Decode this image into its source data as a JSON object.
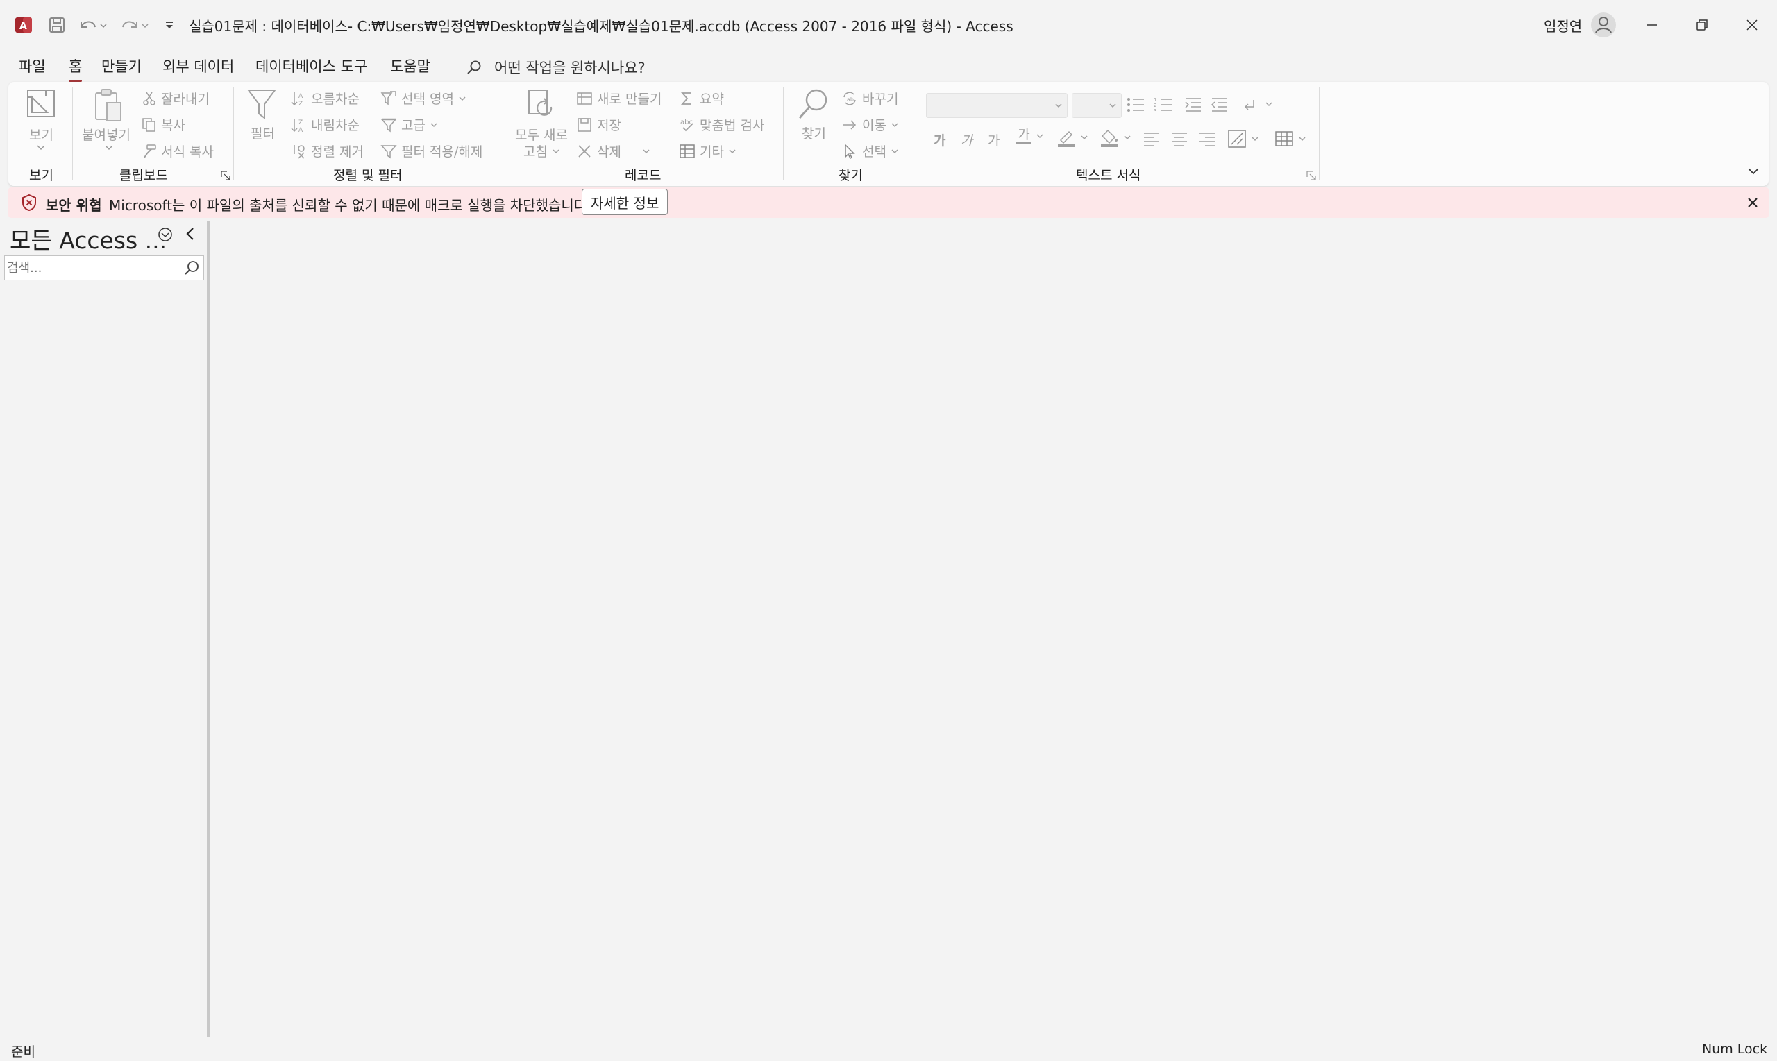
{
  "title_bar": {
    "title": "실습01문제 : 데이터베이스- C:₩Users₩임정연₩Desktop₩실습예제₩실습01문제.accdb (Access 2007 - 2016 파일 형식)  -  Access",
    "user_name": "임정연",
    "app_icon": "access-app-icon",
    "qat_icons": [
      "save-icon",
      "undo-icon",
      "redo-icon",
      "customize-qat-icon"
    ]
  },
  "menu": {
    "tabs": [
      {
        "label": "파일"
      },
      {
        "label": "홈",
        "active": true
      },
      {
        "label": "만들기"
      },
      {
        "label": "외부 데이터"
      },
      {
        "label": "데이터베이스 도구"
      },
      {
        "label": "도움말"
      }
    ],
    "tell_me": "어떤 작업을 원하시나요?"
  },
  "ribbon": {
    "groups": {
      "view": {
        "label": "보기",
        "view_button": "보기"
      },
      "clipboard": {
        "label": "클립보드",
        "paste": "붙여넣기",
        "cut": "잘라내기",
        "copy": "복사",
        "format_painter": "서식 복사"
      },
      "sort_filter": {
        "label": "정렬 및 필터",
        "filter": "필터",
        "ascending": "오름차순",
        "descending": "내림차순",
        "remove_sort": "정렬 제거",
        "selection": "선택 영역",
        "advanced": "고급",
        "toggle_filter": "필터 적용/해제"
      },
      "records": {
        "label": "레코드",
        "refresh_all_1": "모두 새로",
        "refresh_all_2": "고침",
        "new": "새로 만들기",
        "save": "저장",
        "delete": "삭제",
        "totals": "요약",
        "spelling": "맞춤법 검사",
        "more": "기타"
      },
      "find": {
        "label": "찾기",
        "find": "찾기",
        "replace": "바꾸기",
        "goto": "이동",
        "select": "선택"
      },
      "text_format": {
        "label": "텍스트 서식",
        "bold": "가",
        "italic": "가",
        "underline": "가",
        "font_color": "가"
      }
    }
  },
  "security_bar": {
    "title": "보안 위협",
    "message": "Microsoft는 이 파일의 출처를 신뢰할 수 없기 때문에 매크로 실행을 차단했습니다.",
    "button": "자세한 정보"
  },
  "nav_pane": {
    "title": "모든 Access ...",
    "search_placeholder": "검색..."
  },
  "status_bar": {
    "left": "준비",
    "right": "Num Lock"
  },
  "colors": {
    "accent": "#a4373a",
    "security_bar_bg": "#fde7e9",
    "ribbon_disabled": "#a0a0a0"
  }
}
